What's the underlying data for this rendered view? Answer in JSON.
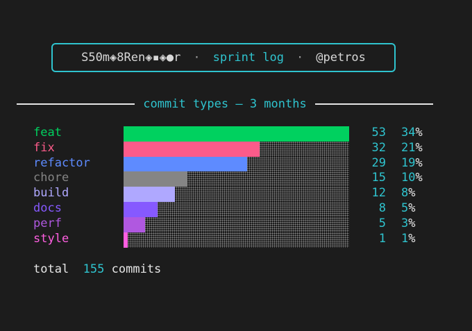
{
  "header": {
    "name": "S50m◈8Ren◈▪◈●r",
    "separator": "·",
    "log": "sprint log",
    "user": "@petros"
  },
  "section": {
    "title": "commit types — 3 months"
  },
  "chart_data": {
    "type": "bar",
    "categories": [
      "feat",
      "fix",
      "refactor",
      "chore",
      "build",
      "docs",
      "perf",
      "style"
    ],
    "values": [
      53,
      32,
      29,
      15,
      12,
      8,
      5,
      1
    ],
    "percents": [
      "34",
      "21",
      "19",
      "10",
      "8",
      "5",
      "3",
      "1"
    ],
    "colors": [
      "#00d15f",
      "#fc5b8a",
      "#5e8bff",
      "#858585",
      "#afa8ff",
      "#8659ff",
      "#b058e0",
      "#ff5fe1"
    ],
    "percent_symbol": "%",
    "xlim": [
      0,
      53
    ]
  },
  "total": {
    "label": "total",
    "value": "155",
    "unit": "commits"
  }
}
